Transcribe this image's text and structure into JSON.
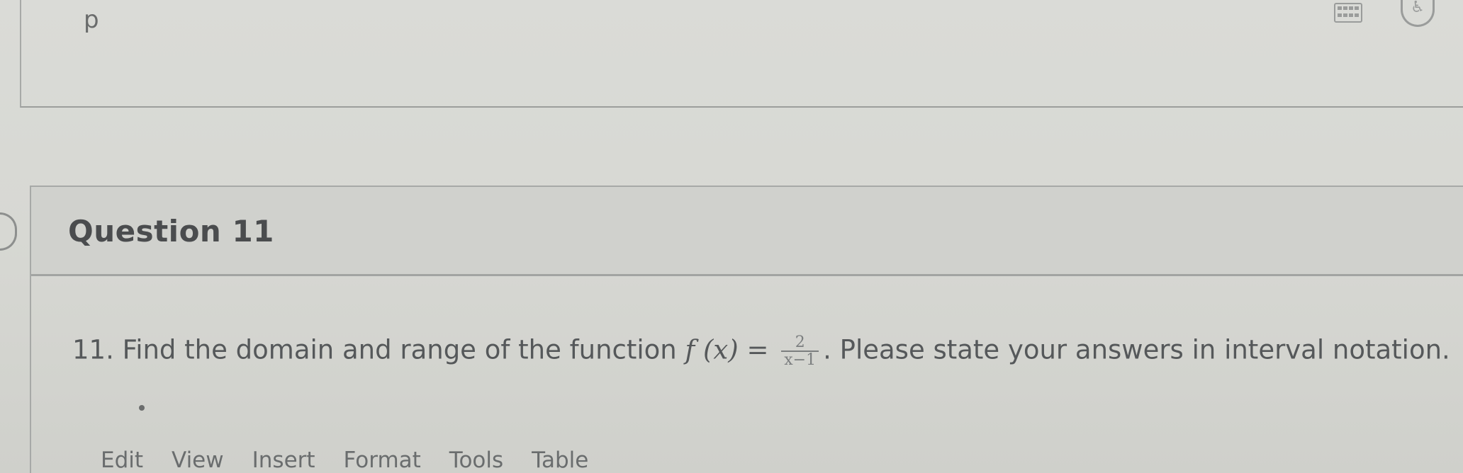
{
  "prev_editor": {
    "text": "p",
    "icons": [
      "keyboard-icon",
      "accessibility-icon"
    ]
  },
  "question": {
    "title": "Question 11",
    "body_prefix": "11. Find the domain and range of the function",
    "function_lhs": "f (x) =",
    "fraction": {
      "numerator": "2",
      "denominator": "x−1"
    },
    "body_suffix": ". Please state your answers in interval notation."
  },
  "editor_menu": {
    "items": [
      "Edit",
      "View",
      "Insert",
      "Format",
      "Tools",
      "Table"
    ]
  },
  "colors": {
    "background": "#d9dad6",
    "text": "#4b4d4f",
    "border": "#a7a9a7"
  }
}
